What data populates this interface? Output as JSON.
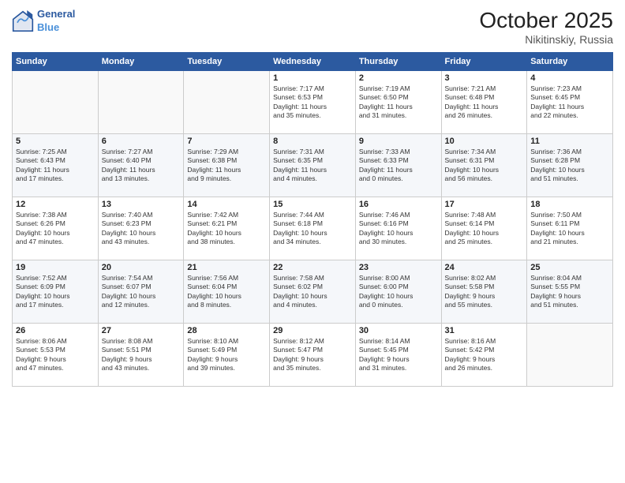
{
  "logo": {
    "line1": "General",
    "line2": "Blue"
  },
  "title": "October 2025",
  "subtitle": "Nikitinskiy, Russia",
  "days_header": [
    "Sunday",
    "Monday",
    "Tuesday",
    "Wednesday",
    "Thursday",
    "Friday",
    "Saturday"
  ],
  "weeks": [
    [
      {
        "day": "",
        "content": ""
      },
      {
        "day": "",
        "content": ""
      },
      {
        "day": "",
        "content": ""
      },
      {
        "day": "1",
        "content": "Sunrise: 7:17 AM\nSunset: 6:53 PM\nDaylight: 11 hours\nand 35 minutes."
      },
      {
        "day": "2",
        "content": "Sunrise: 7:19 AM\nSunset: 6:50 PM\nDaylight: 11 hours\nand 31 minutes."
      },
      {
        "day": "3",
        "content": "Sunrise: 7:21 AM\nSunset: 6:48 PM\nDaylight: 11 hours\nand 26 minutes."
      },
      {
        "day": "4",
        "content": "Sunrise: 7:23 AM\nSunset: 6:45 PM\nDaylight: 11 hours\nand 22 minutes."
      }
    ],
    [
      {
        "day": "5",
        "content": "Sunrise: 7:25 AM\nSunset: 6:43 PM\nDaylight: 11 hours\nand 17 minutes."
      },
      {
        "day": "6",
        "content": "Sunrise: 7:27 AM\nSunset: 6:40 PM\nDaylight: 11 hours\nand 13 minutes."
      },
      {
        "day": "7",
        "content": "Sunrise: 7:29 AM\nSunset: 6:38 PM\nDaylight: 11 hours\nand 9 minutes."
      },
      {
        "day": "8",
        "content": "Sunrise: 7:31 AM\nSunset: 6:35 PM\nDaylight: 11 hours\nand 4 minutes."
      },
      {
        "day": "9",
        "content": "Sunrise: 7:33 AM\nSunset: 6:33 PM\nDaylight: 11 hours\nand 0 minutes."
      },
      {
        "day": "10",
        "content": "Sunrise: 7:34 AM\nSunset: 6:31 PM\nDaylight: 10 hours\nand 56 minutes."
      },
      {
        "day": "11",
        "content": "Sunrise: 7:36 AM\nSunset: 6:28 PM\nDaylight: 10 hours\nand 51 minutes."
      }
    ],
    [
      {
        "day": "12",
        "content": "Sunrise: 7:38 AM\nSunset: 6:26 PM\nDaylight: 10 hours\nand 47 minutes."
      },
      {
        "day": "13",
        "content": "Sunrise: 7:40 AM\nSunset: 6:23 PM\nDaylight: 10 hours\nand 43 minutes."
      },
      {
        "day": "14",
        "content": "Sunrise: 7:42 AM\nSunset: 6:21 PM\nDaylight: 10 hours\nand 38 minutes."
      },
      {
        "day": "15",
        "content": "Sunrise: 7:44 AM\nSunset: 6:18 PM\nDaylight: 10 hours\nand 34 minutes."
      },
      {
        "day": "16",
        "content": "Sunrise: 7:46 AM\nSunset: 6:16 PM\nDaylight: 10 hours\nand 30 minutes."
      },
      {
        "day": "17",
        "content": "Sunrise: 7:48 AM\nSunset: 6:14 PM\nDaylight: 10 hours\nand 25 minutes."
      },
      {
        "day": "18",
        "content": "Sunrise: 7:50 AM\nSunset: 6:11 PM\nDaylight: 10 hours\nand 21 minutes."
      }
    ],
    [
      {
        "day": "19",
        "content": "Sunrise: 7:52 AM\nSunset: 6:09 PM\nDaylight: 10 hours\nand 17 minutes."
      },
      {
        "day": "20",
        "content": "Sunrise: 7:54 AM\nSunset: 6:07 PM\nDaylight: 10 hours\nand 12 minutes."
      },
      {
        "day": "21",
        "content": "Sunrise: 7:56 AM\nSunset: 6:04 PM\nDaylight: 10 hours\nand 8 minutes."
      },
      {
        "day": "22",
        "content": "Sunrise: 7:58 AM\nSunset: 6:02 PM\nDaylight: 10 hours\nand 4 minutes."
      },
      {
        "day": "23",
        "content": "Sunrise: 8:00 AM\nSunset: 6:00 PM\nDaylight: 10 hours\nand 0 minutes."
      },
      {
        "day": "24",
        "content": "Sunrise: 8:02 AM\nSunset: 5:58 PM\nDaylight: 9 hours\nand 55 minutes."
      },
      {
        "day": "25",
        "content": "Sunrise: 8:04 AM\nSunset: 5:55 PM\nDaylight: 9 hours\nand 51 minutes."
      }
    ],
    [
      {
        "day": "26",
        "content": "Sunrise: 8:06 AM\nSunset: 5:53 PM\nDaylight: 9 hours\nand 47 minutes."
      },
      {
        "day": "27",
        "content": "Sunrise: 8:08 AM\nSunset: 5:51 PM\nDaylight: 9 hours\nand 43 minutes."
      },
      {
        "day": "28",
        "content": "Sunrise: 8:10 AM\nSunset: 5:49 PM\nDaylight: 9 hours\nand 39 minutes."
      },
      {
        "day": "29",
        "content": "Sunrise: 8:12 AM\nSunset: 5:47 PM\nDaylight: 9 hours\nand 35 minutes."
      },
      {
        "day": "30",
        "content": "Sunrise: 8:14 AM\nSunset: 5:45 PM\nDaylight: 9 hours\nand 31 minutes."
      },
      {
        "day": "31",
        "content": "Sunrise: 8:16 AM\nSunset: 5:42 PM\nDaylight: 9 hours\nand 26 minutes."
      },
      {
        "day": "",
        "content": ""
      }
    ]
  ]
}
